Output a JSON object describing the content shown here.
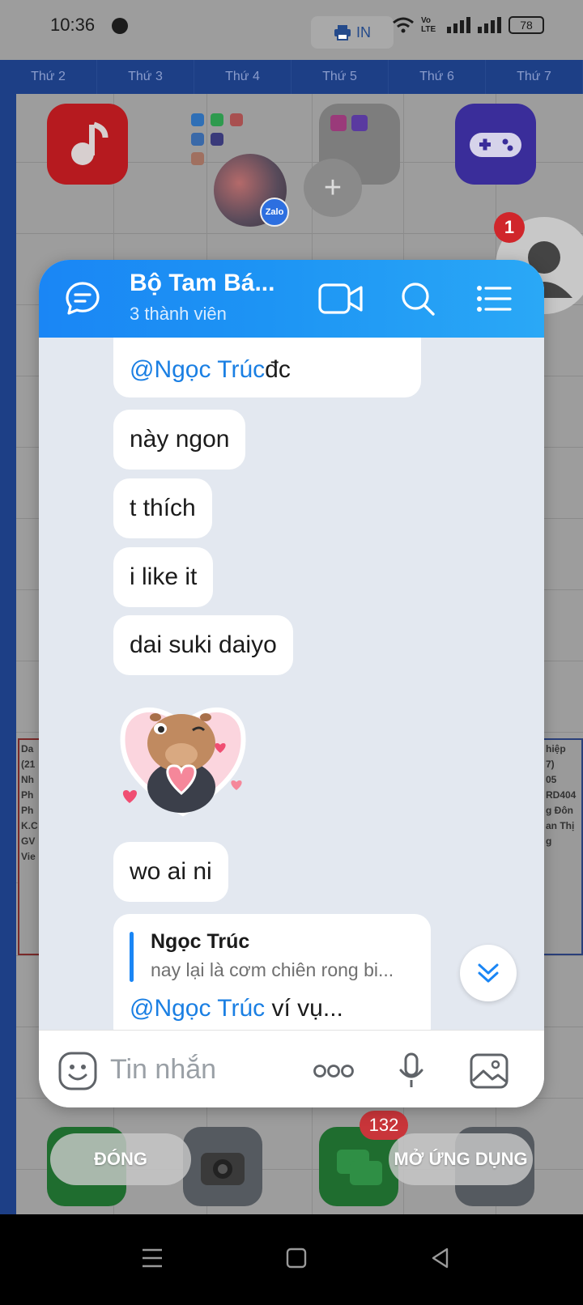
{
  "status_bar": {
    "time": "10:36",
    "print_label": "IN",
    "network_label": "Vo LTE",
    "battery": "78"
  },
  "background": {
    "days": [
      "Thứ 2",
      "Thứ 3",
      "Thứ 4",
      "Thứ 5",
      "Thứ 6",
      "Thứ 7"
    ],
    "left_cell_lines": [
      "Da",
      "(21",
      "Nh",
      "Ph",
      "Ph",
      "K.C",
      "GV",
      "Vie"
    ],
    "right_cell_lines": [
      "hiệp",
      "7)",
      "05",
      "RD404",
      "g Đôn",
      "an Thị",
      "g"
    ]
  },
  "chat": {
    "title": "Bộ Tam Bá...",
    "subtitle": "3 thành viên",
    "messages": [
      {
        "mention": "@Ngọc Trúc",
        "text": " đc"
      },
      {
        "text": "này ngon"
      },
      {
        "text": "t thích"
      },
      {
        "text": "i like it"
      },
      {
        "text": "dai suki daiyo"
      },
      {
        "text": "wo ai ni"
      }
    ],
    "quote": {
      "author": "Ngọc Trúc",
      "preview": "nay lại là cơm chiên rong bi...",
      "mention": "@Ngọc Trúc",
      "text": " ví vụ..."
    },
    "input_placeholder": "Tin nhắn"
  },
  "floating": {
    "close_label": "ĐÓNG",
    "open_app_label": "MỞ ỨNG DỤNG",
    "messages_badge": "132",
    "bubble_count": "1",
    "zalo_badge": "Zalo"
  },
  "colors": {
    "header_blue": "#1a86f5",
    "mention_blue": "#1a7fe3",
    "chat_bg": "#e3e8f0"
  }
}
